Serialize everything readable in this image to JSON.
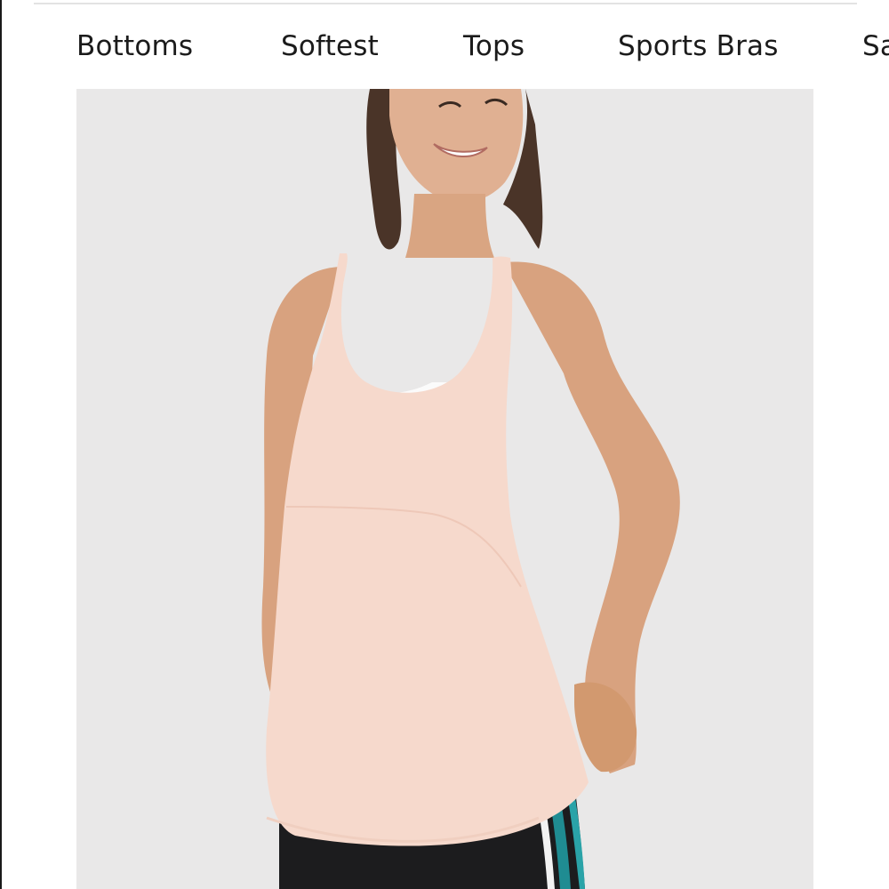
{
  "nav": {
    "items": [
      {
        "label": "Bottoms"
      },
      {
        "label": "Softest"
      },
      {
        "label": "Tops"
      },
      {
        "label": "Sports Bras"
      },
      {
        "label": "Sa"
      }
    ]
  },
  "product": {
    "image_icon": "product-photo",
    "colors": {
      "background": "#e9e8e8",
      "tank": "#f6d9cc",
      "skin": "#d9a582",
      "leggings": "#1c1c1e",
      "stripe_teal": "#1f8c92"
    }
  }
}
